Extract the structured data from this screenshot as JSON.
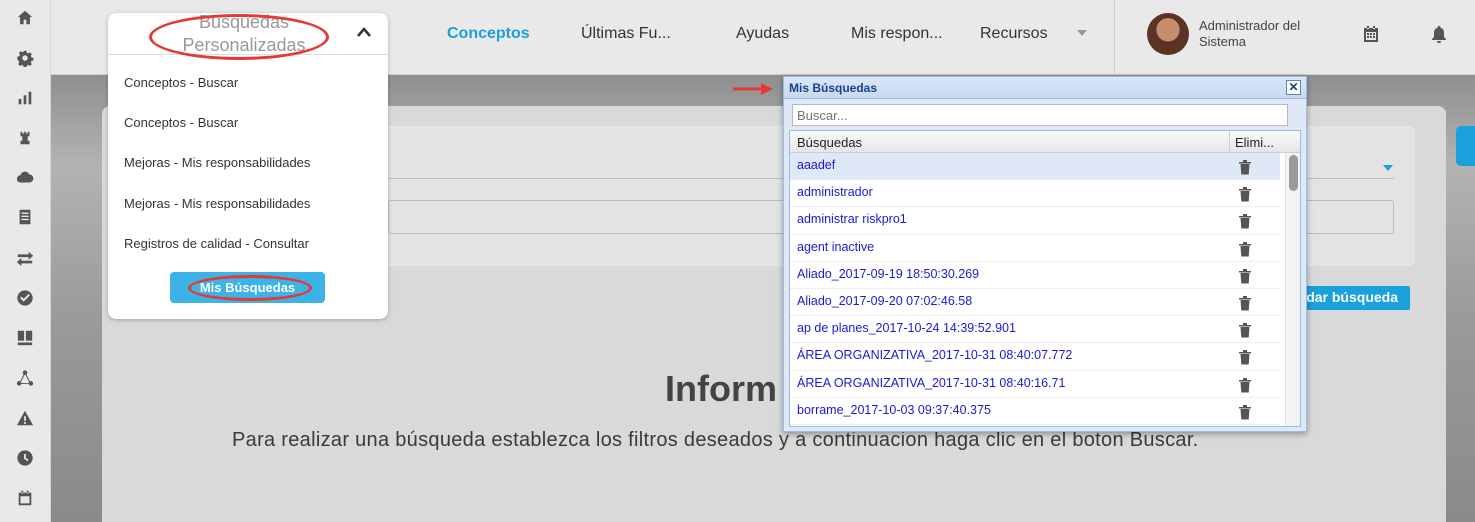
{
  "rail": {
    "icons": [
      "home-icon",
      "gear-icon",
      "bar-chart-icon",
      "rook-icon",
      "cloud-icon",
      "document-icon",
      "swap-icon",
      "check-circle-icon",
      "dashboard-icon",
      "network-icon",
      "warning-icon",
      "clock-icon",
      "calendar-icon"
    ]
  },
  "nav": {
    "items": [
      "Conceptos",
      "Últimas Fu...",
      "Ayudas",
      "Mis respon...",
      "Recursos"
    ]
  },
  "user": {
    "name": "Administrador del Sistema"
  },
  "dropdown": {
    "title": "Busquedas Personalizadas",
    "items": [
      "Conceptos - Buscar",
      "Conceptos - Buscar",
      "Mejoras - Mis responsabilidades",
      "Mejoras - Mis responsabilidades",
      "Registros de calidad - Consultar"
    ],
    "button": "Mis Búsquedas"
  },
  "background": {
    "save_button": "Guardar búsqueda",
    "info_title": "Inform",
    "info_text": "Para realizar una búsqueda establezca los filtros deseados y a continuacion haga clic en el boton Buscar."
  },
  "modal": {
    "title": "Mis Búsquedas",
    "search_placeholder": "Buscar...",
    "col_searches": "Búsquedas",
    "col_delete": "Elimi...",
    "rows": [
      "aaadef",
      "administrador",
      "administrar riskpro1",
      "agent inactive",
      "Aliado_2017-09-19 18:50:30.269",
      "Aliado_2017-09-20 07:02:46.58",
      "ap de planes_2017-10-24 14:39:52.901",
      "ÁREA ORGANIZATIVA_2017-10-31 08:40:07.772",
      "ÁREA ORGANIZATIVA_2017-10-31 08:40:16.71",
      "borrame_2017-10-03 09:37:40.375"
    ]
  },
  "colors": {
    "accent": "#1aa0dc",
    "annotation": "#e53935",
    "link": "#1a1ad8"
  }
}
